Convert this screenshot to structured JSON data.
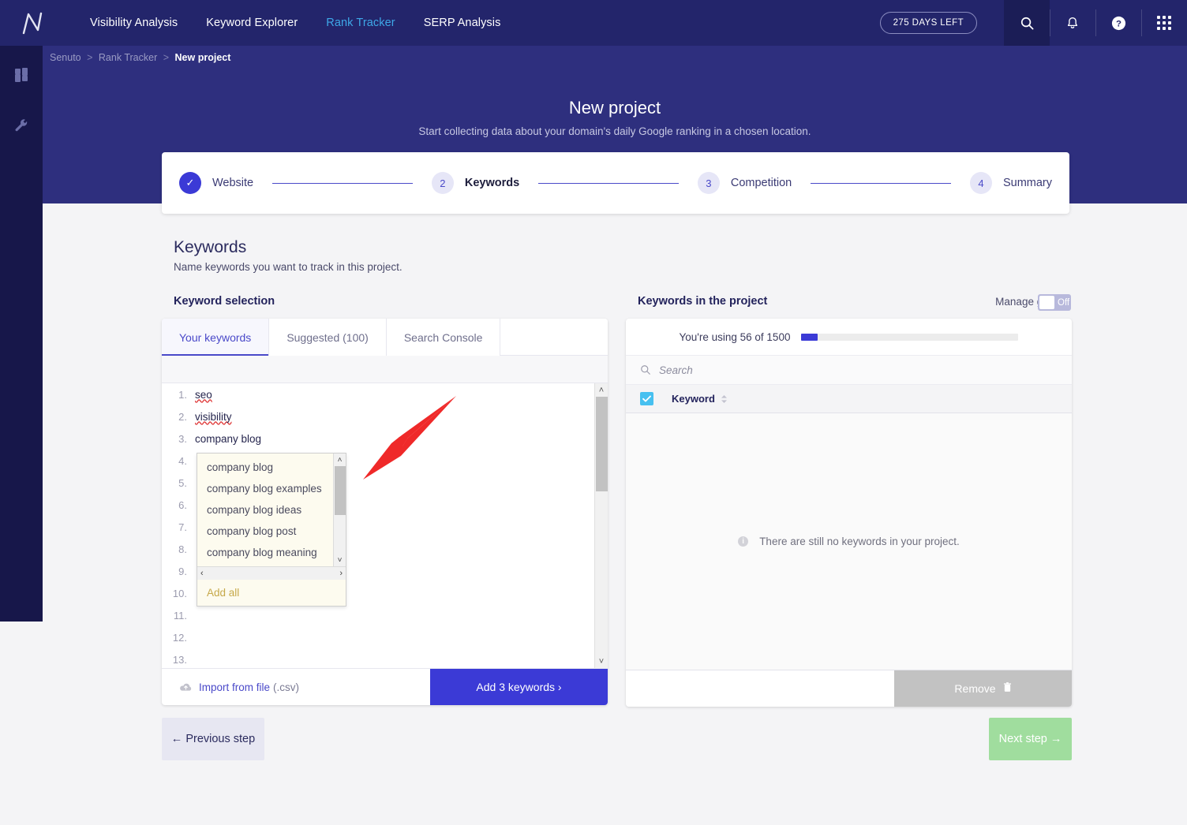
{
  "topbar": {
    "logo_icon": "senuto-logo-icon",
    "nav": [
      {
        "label": "Visibility Analysis",
        "active": false
      },
      {
        "label": "Keyword Explorer",
        "active": false
      },
      {
        "label": "Rank Tracker",
        "active": true
      },
      {
        "label": "SERP Analysis",
        "active": false
      }
    ],
    "days_left": "275 DAYS LEFT",
    "icons": [
      "search-icon",
      "bell-icon",
      "help-icon",
      "apps-grid-icon"
    ]
  },
  "rail": {
    "items": [
      "dashboard-grid-icon",
      "wrench-icon"
    ]
  },
  "breadcrumb": {
    "root": "Senuto",
    "section": "Rank Tracker",
    "current": "New project",
    "separator": ">"
  },
  "hero": {
    "title": "New project",
    "subtitle": "Start collecting data about your domain's daily Google ranking in a chosen location."
  },
  "stepper": {
    "steps": [
      {
        "num": "✓",
        "label": "Website",
        "state": "done"
      },
      {
        "num": "2",
        "label": "Keywords",
        "state": "current"
      },
      {
        "num": "3",
        "label": "Competition",
        "state": "pending"
      },
      {
        "num": "4",
        "label": "Summary",
        "state": "pending"
      }
    ]
  },
  "page": {
    "title": "Keywords",
    "subtitle": "Name keywords you want to track in this project."
  },
  "selection": {
    "heading": "Keyword selection",
    "tabs": [
      {
        "label": "Your keywords",
        "active": true
      },
      {
        "label": "Suggested (100)",
        "active": false
      },
      {
        "label": "Search Console",
        "active": false
      }
    ],
    "rows": [
      {
        "n": "1.",
        "text": "seo",
        "spellcheck": true
      },
      {
        "n": "2.",
        "text": "visibility",
        "spellcheck": true
      },
      {
        "n": "3.",
        "text": "company blog",
        "spellcheck": false
      },
      {
        "n": "4.",
        "text": "",
        "spellcheck": false
      },
      {
        "n": "5.",
        "text": "",
        "spellcheck": false
      },
      {
        "n": "6.",
        "text": "",
        "spellcheck": false
      },
      {
        "n": "7.",
        "text": "",
        "spellcheck": false
      },
      {
        "n": "8.",
        "text": "",
        "spellcheck": false
      },
      {
        "n": "9.",
        "text": "",
        "spellcheck": false
      },
      {
        "n": "10.",
        "text": "",
        "spellcheck": false
      },
      {
        "n": "11.",
        "text": "",
        "spellcheck": false
      },
      {
        "n": "12.",
        "text": "",
        "spellcheck": false
      },
      {
        "n": "13.",
        "text": "",
        "spellcheck": false
      }
    ],
    "autocomplete": {
      "items": [
        "company blog",
        "company blog examples",
        "company blog ideas",
        "company blog post",
        "company blog meaning"
      ],
      "add_all": "Add all",
      "scroll_left": "‹",
      "scroll_right": "›",
      "arrow_up": "˄",
      "arrow_down": "˅"
    },
    "import_label": "Import from file",
    "import_suffix": "(.csv)",
    "add_button": "Add 3 keywords ›"
  },
  "project": {
    "heading": "Keywords in the project",
    "manage_groups_label": "Manage groups",
    "toggle_state": "Off",
    "usage_text": "You're using 56 of 1500",
    "usage_used": 56,
    "usage_total": 1500,
    "search_placeholder": "Search",
    "column_header": "Keyword",
    "empty_message": "There are still no keywords in your project.",
    "remove_button": "Remove"
  },
  "footer": {
    "previous": "← Previous step",
    "next": "Next step →"
  },
  "colors": {
    "brand_dark": "#23256b",
    "hero": "#2e2f7e",
    "accent_blue": "#3b3ad6",
    "accent_cyan": "#3ea8e8",
    "checkbox": "#47c0f0",
    "next_green": "#a0dd9e",
    "remove_grey": "#c2c2c2",
    "dropdown_bg": "#fdfbef",
    "annotation_red": "#ef2929"
  }
}
